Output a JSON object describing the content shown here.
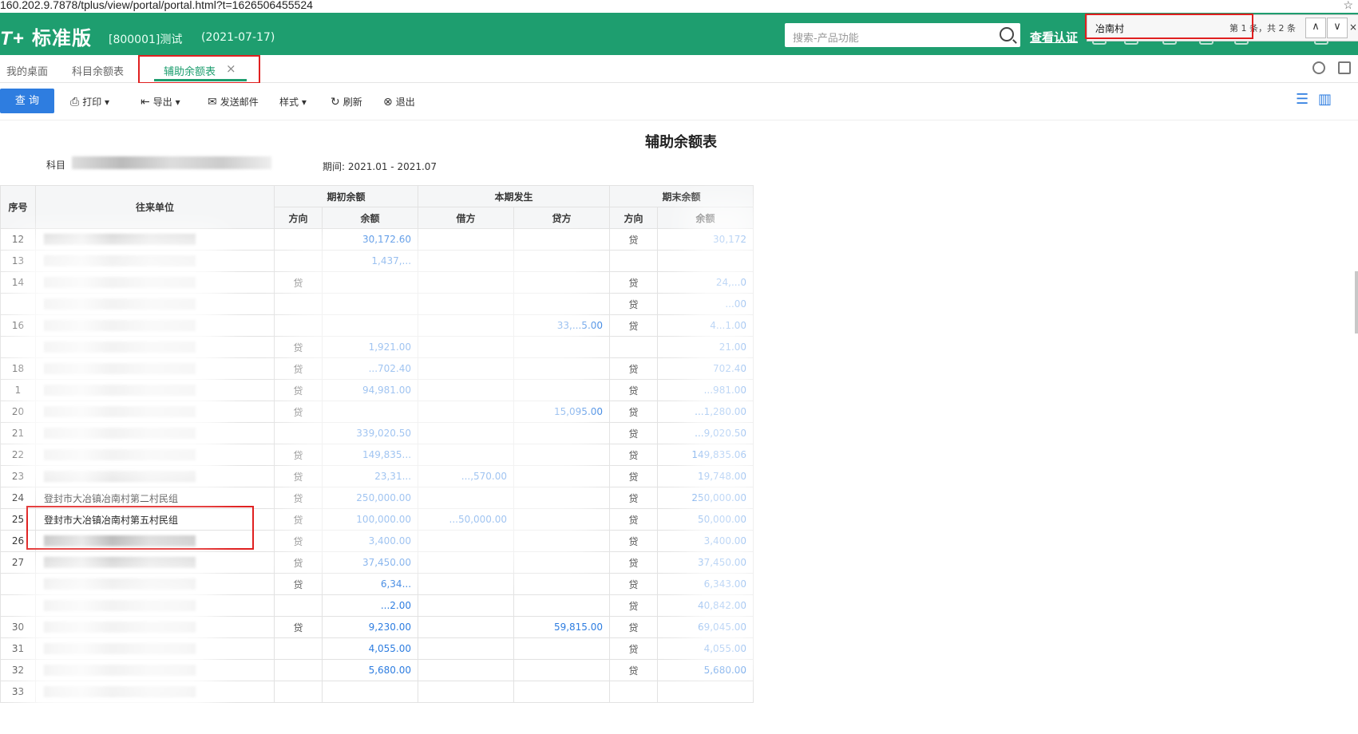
{
  "browser": {
    "url": "160.202.9.7878/tplus/view/portal/portal.html?t=1626506455524",
    "star": "☆"
  },
  "header": {
    "logo_mark": "T+",
    "logo_text": "标准版",
    "account": "[800001]测试",
    "date": "(2021-07-17)",
    "search_placeholder": "搜索-产品功能",
    "cert_link": "查看认证"
  },
  "findbar": {
    "query": "冶南村",
    "count_text": "第 1 条，共 2 条",
    "prev": "∧",
    "next": "∨",
    "close": "×"
  },
  "tabs": [
    {
      "label": "我的桌面"
    },
    {
      "label": "科目余额表"
    },
    {
      "label": "辅助余额表",
      "close": "×"
    }
  ],
  "toolbar": {
    "query": "查 询",
    "print": "打印",
    "export": "导出",
    "email": "发送邮件",
    "style": "样式",
    "refresh": "刷新",
    "exit": "退出"
  },
  "report": {
    "title": "辅助余额表",
    "subject_label": "科目",
    "period": "期间:  2021.01 - 2021.07"
  },
  "table": {
    "h_idx": "序号",
    "h_party": "往来单位",
    "h_open": "期初余额",
    "h_cur": "本期发生",
    "h_end": "期末余额",
    "h_dir": "方向",
    "h_bal": "余额",
    "h_debit": "借方",
    "h_credit": "贷方",
    "h_enddir": "方向",
    "h_endbal": "余额",
    "rows": [
      {
        "idx": "12",
        "party": "",
        "odir": "",
        "obal": "30,172.60",
        "debit": "",
        "credit": "",
        "edir": "贷",
        "ebal": "30,172"
      },
      {
        "idx": "13",
        "party": "",
        "odir": "",
        "obal": "1,437,...",
        "debit": "",
        "credit": "",
        "edir": "",
        "ebal": ""
      },
      {
        "idx": "14",
        "party": "",
        "odir": "贷",
        "obal": "",
        "debit": "",
        "credit": "",
        "edir": "贷",
        "ebal": "24,...0"
      },
      {
        "idx": "",
        "party": "",
        "odir": "",
        "obal": "",
        "debit": "",
        "credit": "",
        "edir": "贷",
        "ebal": "...00"
      },
      {
        "idx": "16",
        "party": "",
        "odir": "",
        "obal": "",
        "debit": "",
        "credit": "33,...5.00",
        "edir": "贷",
        "ebal": "4...1.00"
      },
      {
        "idx": "",
        "party": "",
        "odir": "贷",
        "obal": "1,921.00",
        "debit": "",
        "credit": "",
        "edir": "",
        "ebal": "21.00"
      },
      {
        "idx": "18",
        "party": "",
        "odir": "贷",
        "obal": "...702.40",
        "debit": "",
        "credit": "",
        "edir": "贷",
        "ebal": "702.40"
      },
      {
        "idx": "1",
        "party": "",
        "odir": "贷",
        "obal": "94,981.00",
        "debit": "",
        "credit": "",
        "edir": "贷",
        "ebal": "...981.00"
      },
      {
        "idx": "20",
        "party": "",
        "odir": "贷",
        "obal": "",
        "debit": "",
        "credit": "15,095.00",
        "edir": "贷",
        "ebal": "...1,280.00"
      },
      {
        "idx": "21",
        "party": "",
        "odir": "",
        "obal": "339,020.50",
        "debit": "",
        "credit": "",
        "edir": "贷",
        "ebal": "...9,020.50"
      },
      {
        "idx": "22",
        "party": "",
        "odir": "贷",
        "obal": "149,835...",
        "debit": "",
        "credit": "",
        "edir": "贷",
        "ebal": "149,835.06"
      },
      {
        "idx": "23",
        "party": "",
        "odir": "贷",
        "obal": "23,31...",
        "debit": "...,570.00",
        "credit": "",
        "edir": "贷",
        "ebal": "19,748.00"
      },
      {
        "idx": "24",
        "party": "登封市大冶镇冶南村第二村民组",
        "odir": "贷",
        "obal": "250,000.00",
        "debit": "",
        "credit": "",
        "edir": "贷",
        "ebal": "250,000.00"
      },
      {
        "idx": "25",
        "party": "登封市大冶镇冶南村第五村民组",
        "odir": "贷",
        "obal": "100,000.00",
        "debit": "...50,000.00",
        "credit": "",
        "edir": "贷",
        "ebal": "50,000.00"
      },
      {
        "idx": "26",
        "party": "",
        "odir": "贷",
        "obal": "3,400.00",
        "debit": "",
        "credit": "",
        "edir": "贷",
        "ebal": "3,400.00"
      },
      {
        "idx": "27",
        "party": "",
        "odir": "贷",
        "obal": "37,450.00",
        "debit": "",
        "credit": "",
        "edir": "贷",
        "ebal": "37,450.00"
      },
      {
        "idx": "",
        "party": "",
        "odir": "贷",
        "obal": "6,34...",
        "debit": "",
        "credit": "",
        "edir": "贷",
        "ebal": "6,343.00"
      },
      {
        "idx": "",
        "party": "",
        "odir": "",
        "obal": "...2.00",
        "debit": "",
        "credit": "",
        "edir": "贷",
        "ebal": "40,842.00"
      },
      {
        "idx": "30",
        "party": "",
        "odir": "贷",
        "obal": "9,230.00",
        "debit": "",
        "credit": "59,815.00",
        "edir": "贷",
        "ebal": "69,045.00"
      },
      {
        "idx": "31",
        "party": "",
        "odir": "",
        "obal": "4,055.00",
        "debit": "",
        "credit": "",
        "edir": "贷",
        "ebal": "4,055.00"
      },
      {
        "idx": "32",
        "party": "",
        "odir": "",
        "obal": "5,680.00",
        "debit": "",
        "credit": "",
        "edir": "贷",
        "ebal": "5,680.00"
      },
      {
        "idx": "33",
        "party": "",
        "odir": "",
        "obal": "",
        "debit": "",
        "credit": "",
        "edir": "",
        "ebal": ""
      }
    ]
  },
  "colors": {
    "brand": "#1e9e6f",
    "link": "#2e7de0",
    "highlight": "#e02020"
  },
  "icons": [
    "search-icon",
    "print-icon",
    "export-icon",
    "email-icon",
    "refresh-icon",
    "exit-icon",
    "list-view-icon",
    "chart-view-icon"
  ]
}
